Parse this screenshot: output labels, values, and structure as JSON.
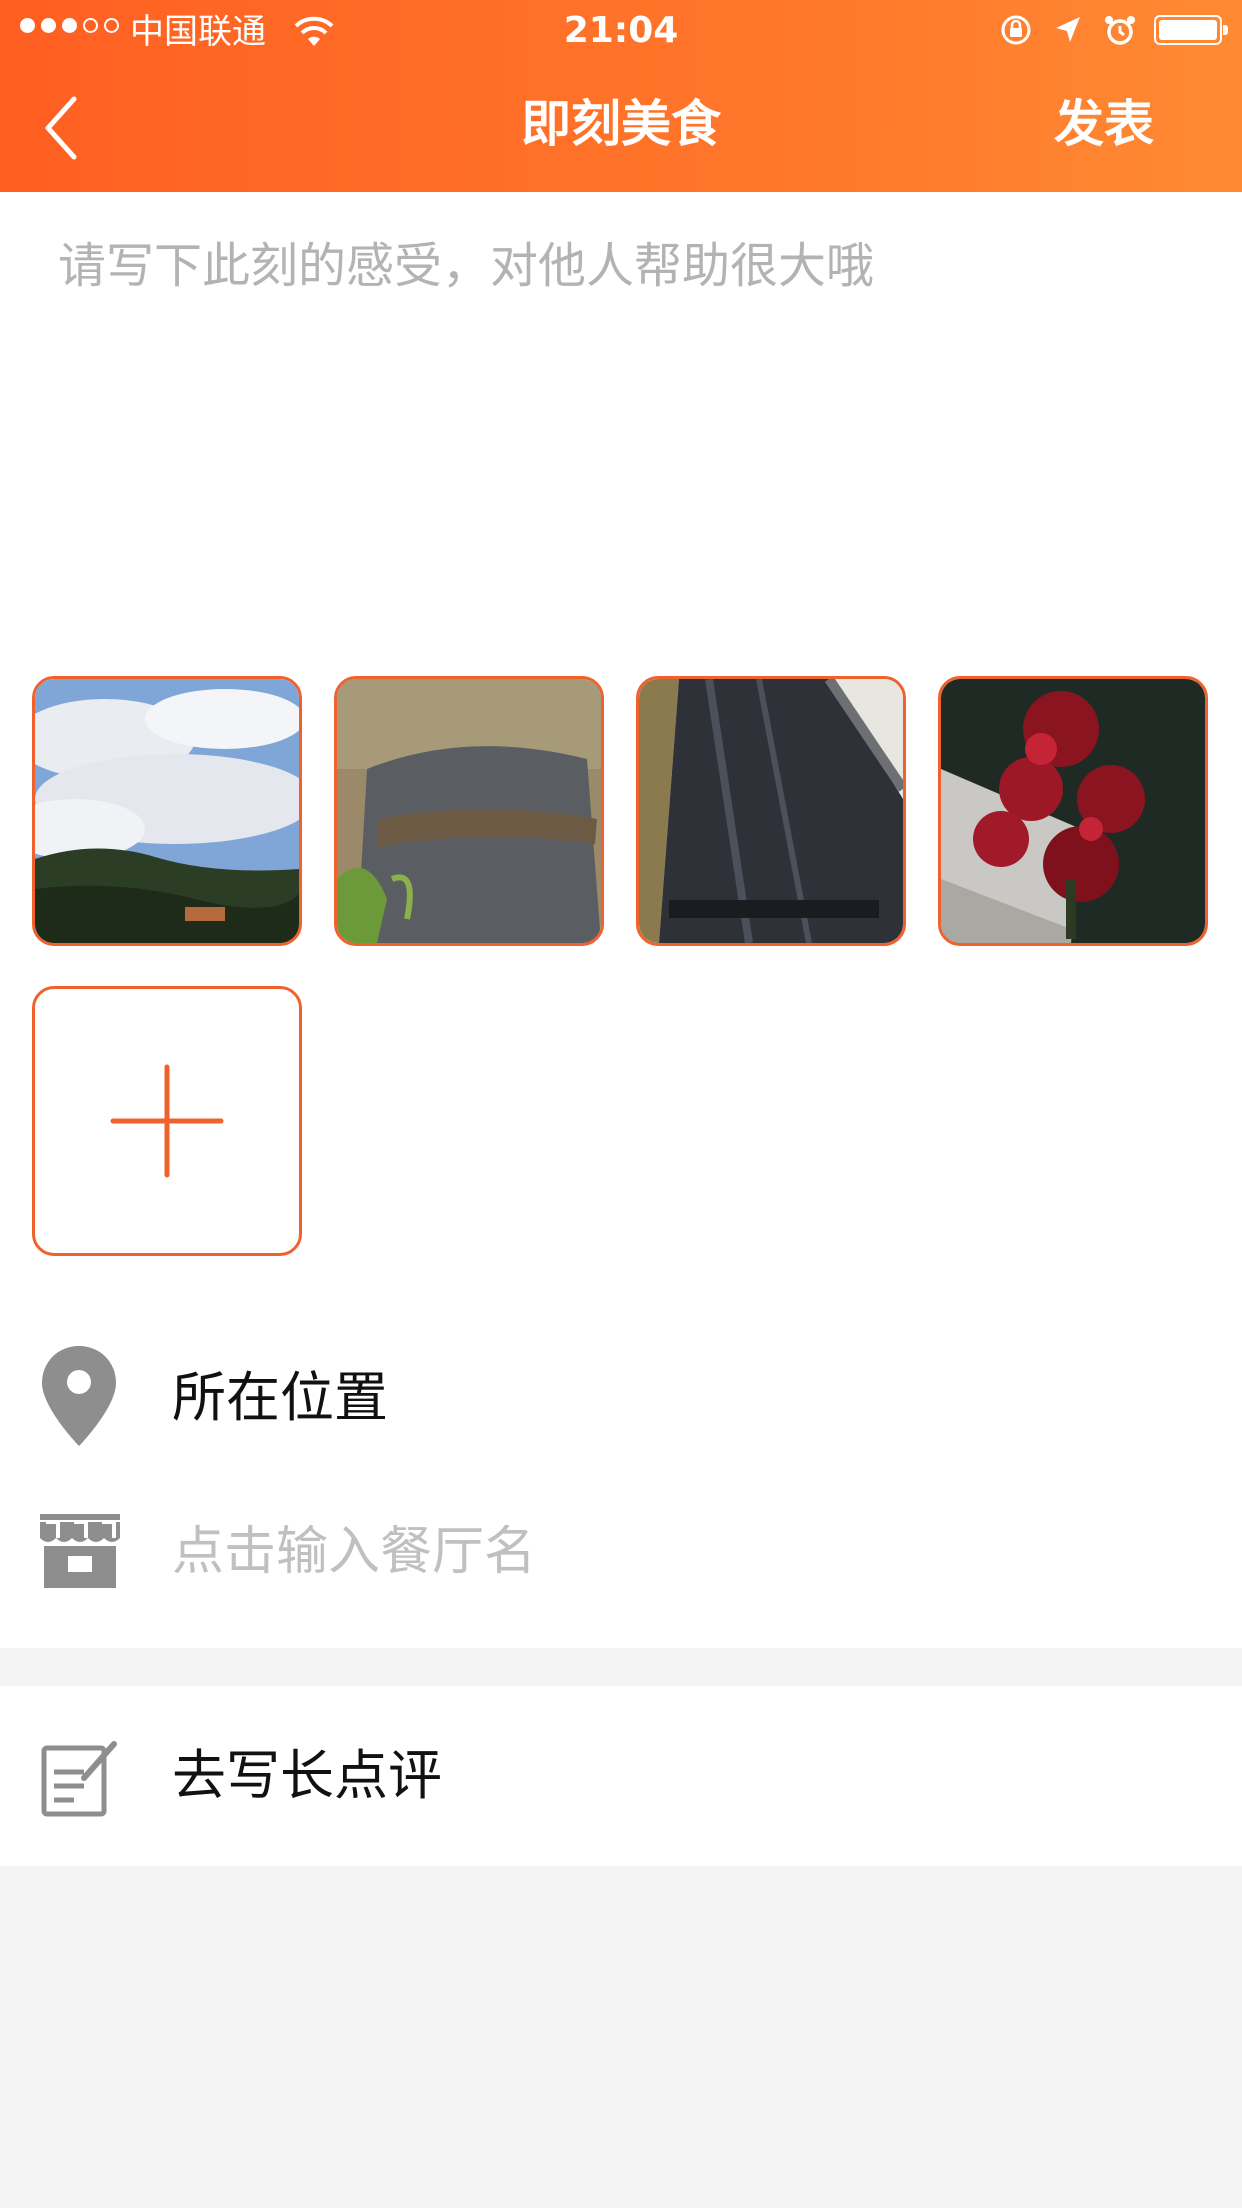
{
  "status_bar": {
    "carrier": "中国联通",
    "time": "21:04",
    "battery_level": 1.0
  },
  "nav": {
    "title": "即刻美食",
    "publish_label": "发表",
    "back_icon": "chevron-left-icon"
  },
  "composer": {
    "placeholder": "请写下此刻的感受，对他人帮助很大哦"
  },
  "photos": [
    {
      "icon": "photo-sky-mountains"
    },
    {
      "icon": "photo-rock-branch"
    },
    {
      "icon": "photo-water-channel"
    },
    {
      "icon": "photo-red-flowers"
    }
  ],
  "add_photo": {
    "icon": "plus-icon"
  },
  "location": {
    "label": "所在位置",
    "icon": "location-pin-icon"
  },
  "restaurant": {
    "placeholder": "点击输入餐厅名",
    "icon": "storefront-icon"
  },
  "long_review": {
    "label": "去写长点评",
    "icon": "edit-note-icon"
  },
  "colors": {
    "header_start": "#ff5f21",
    "header_end": "#ff8a33",
    "accent": "#f0622d",
    "placeholder": "#b3b3b3",
    "icon_gray": "#8e8e8e"
  }
}
